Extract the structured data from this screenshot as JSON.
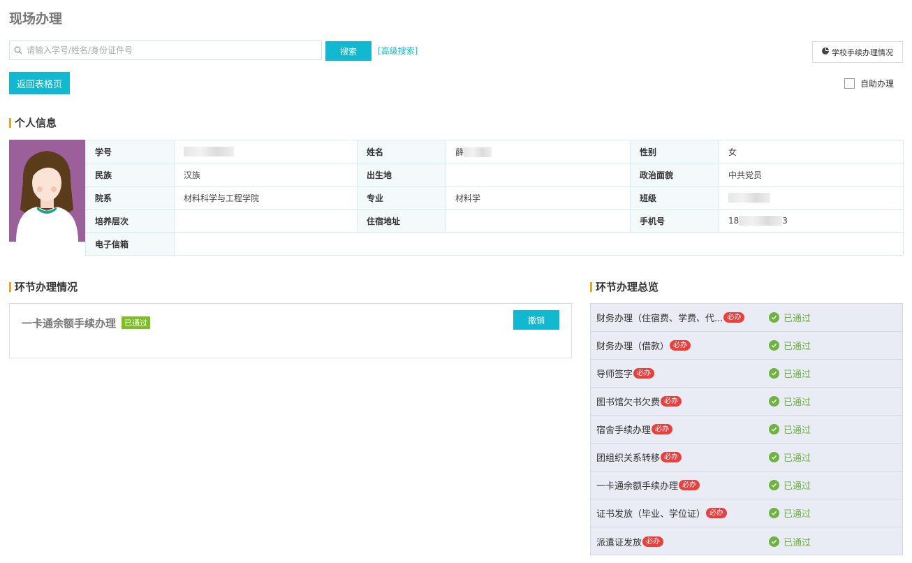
{
  "page": {
    "title": "现场办理"
  },
  "search": {
    "placeholder": "请输入学号/姓名/身份证件号",
    "button_label": "搜索",
    "advanced_label": "[高级搜索]"
  },
  "toolbar": {
    "school_status_label": "学校手续办理情况",
    "back_label": "返回表格页",
    "self_service_label": "自助办理"
  },
  "personal_info": {
    "section_title": "个人信息",
    "labels": {
      "student_id": "学号",
      "name": "姓名",
      "gender": "性别",
      "ethnicity": "民族",
      "birthplace": "出生地",
      "political_status": "政治面貌",
      "department": "院系",
      "major": "专业",
      "class": "班级",
      "education_level": "培养层次",
      "dorm_address": "住宿地址",
      "phone": "手机号",
      "email": "电子信箱"
    },
    "values": {
      "name_visible": "薛",
      "gender": "女",
      "ethnicity": "汉族",
      "political_status": "中共党员",
      "department": "材料科学与工程学院",
      "major": "材料学",
      "phone_prefix": "18",
      "phone_suffix": "3"
    }
  },
  "process_status": {
    "section_title": "环节办理情况",
    "item_name": "一卡通余额手续办理",
    "item_badge": "已通过",
    "cancel_label": "撤销"
  },
  "overview": {
    "section_title": "环节办理总览",
    "required_badge": "必办",
    "status_label": "已通过",
    "items": [
      {
        "name": "财务办理（住宿费、学费、代..."
      },
      {
        "name": "财务办理（借款）"
      },
      {
        "name": "导师签字"
      },
      {
        "name": "图书馆欠书欠费"
      },
      {
        "name": "宿舍手续办理"
      },
      {
        "name": "团组织关系转移"
      },
      {
        "name": "一卡通余额手续办理"
      },
      {
        "name": "证书发放（毕业、学位证）"
      },
      {
        "name": "派遣证发放"
      }
    ]
  },
  "colors": {
    "accent": "#12b8cf",
    "section_marker": "#f0a31b",
    "passed_green": "#6cb33f",
    "required_red": "#e8403d"
  }
}
